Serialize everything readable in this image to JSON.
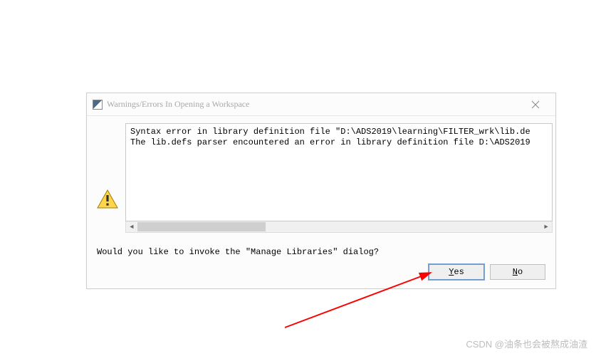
{
  "dialog": {
    "title": "Warnings/Errors In Opening a Workspace",
    "error_line1": "Syntax error in library definition file \"D:\\ADS2019\\learning\\FILTER_wrk\\lib.de",
    "error_line2": "The lib.defs parser encountered an error in library definition file D:\\ADS2019",
    "question": "Would you like to invoke the \"Manage Libraries\" dialog?",
    "yes_mnemonic": "Y",
    "yes_rest": "es",
    "no_mnemonic": "N",
    "no_rest": "o"
  },
  "watermark": "CSDN @油条也会被熬成油渣"
}
